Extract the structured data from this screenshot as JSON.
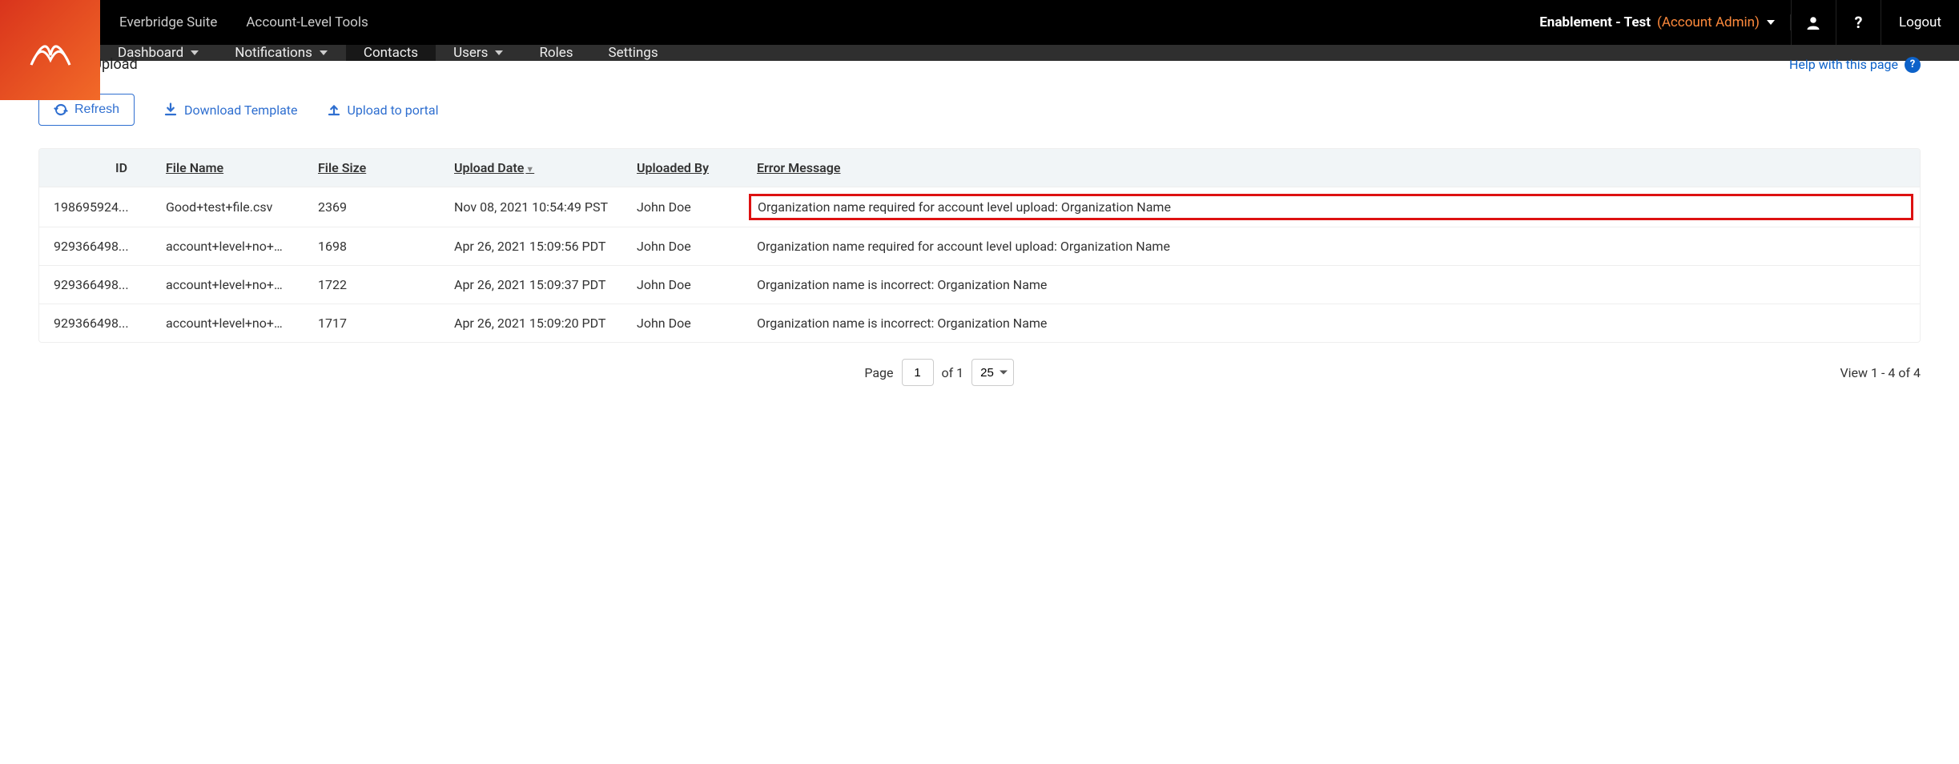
{
  "topbar": {
    "suite_link": "Everbridge Suite",
    "tools_link": "Account-Level Tools",
    "account_name": "Enablement - Test",
    "account_role": "(Account Admin)",
    "logout": "Logout"
  },
  "nav": {
    "dashboard": "Dashboard",
    "notifications": "Notifications",
    "contacts": "Contacts",
    "users": "Users",
    "roles": "Roles",
    "settings": "Settings"
  },
  "page": {
    "title": "Contact Upload",
    "help": "Help with this page"
  },
  "actions": {
    "refresh": "Refresh",
    "download": "Download Template",
    "upload": "Upload to portal"
  },
  "table": {
    "headers": {
      "id": "ID",
      "file": "File Name",
      "size": "File Size",
      "date": "Upload Date",
      "by": "Uploaded By",
      "err": "Error Message"
    },
    "rows": [
      {
        "id": "198695924...",
        "file": "Good+test+file.csv",
        "size": "2369",
        "date": "Nov 08, 2021 10:54:49 PST",
        "by": "John Doe",
        "err": "Organization name required for account level upload: Organization Name",
        "highlight": true
      },
      {
        "id": "929366498...",
        "file": "account+level+no+or...",
        "size": "1698",
        "date": "Apr 26, 2021 15:09:56 PDT",
        "by": "John Doe",
        "err": "Organization name required for account level upload: Organization Name",
        "highlight": false
      },
      {
        "id": "929366498...",
        "file": "account+level+no+or...",
        "size": "1722",
        "date": "Apr 26, 2021 15:09:37 PDT",
        "by": "John Doe",
        "err": "Organization name is incorrect: Organization Name",
        "highlight": false
      },
      {
        "id": "929366498...",
        "file": "account+level+no+or...",
        "size": "1717",
        "date": "Apr 26, 2021 15:09:20 PDT",
        "by": "John Doe",
        "err": "Organization name is incorrect: Organization Name",
        "highlight": false
      }
    ]
  },
  "pager": {
    "page_label": "Page",
    "current": "1",
    "of_label": "of 1",
    "per_page": "25",
    "summary": "View 1 - 4 of 4"
  }
}
